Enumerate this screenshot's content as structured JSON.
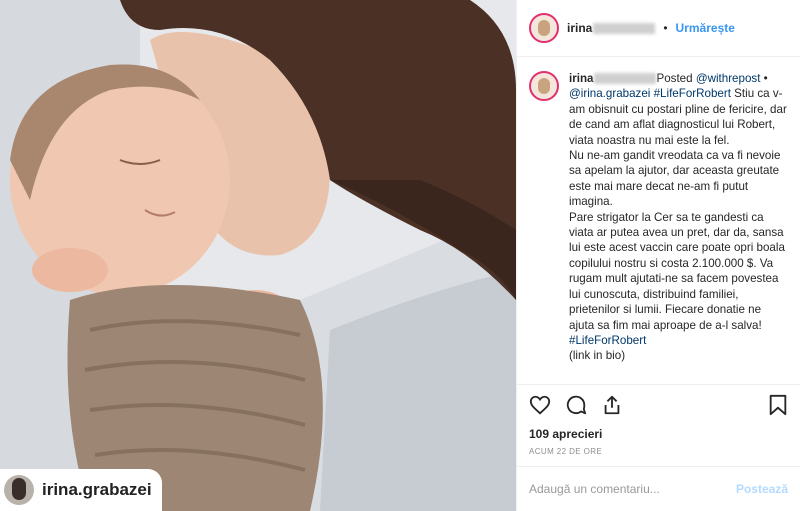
{
  "photo": {
    "credit_name": "irina.grabazei"
  },
  "header": {
    "username_prefix": "irina",
    "separator": "•",
    "follow_label": "Urmărește"
  },
  "caption": {
    "username_prefix": "irina",
    "text_1": "Posted ",
    "mention_1": "@withrepost",
    "text_2": " • ",
    "mention_2": "@irina.grabazei",
    "text_3": " ",
    "hashtag_1": "#LifeForRobert",
    "text_4": " Stiu ca v-am obisnuit cu postari pline de fericire, dar de cand am aflat diagnosticul lui Robert, viata noastra nu mai este la fel.",
    "para_2": "Nu ne-am gandit vreodata ca va fi nevoie sa apelam la ajutor, dar aceasta greutate este mai mare decat ne-am fi putut imagina.",
    "para_3": "Pare strigator la Cer sa te gandesti ca viata ar putea avea un pret, dar da, sansa lui este acest vaccin care poate opri boala copilului nostru si costa 2.100.000 $. Va rugam mult ajutati-ne sa facem povestea lui cunoscuta, distribuind familiei, prietenilor si lumii. Fiecare donatie ne ajuta sa fim mai aproape de a-l salva! ",
    "hashtag_2": "#LifeForRobert",
    "para_4": "(link in bio)"
  },
  "likes": "109 aprecieri",
  "timestamp": "ACUM 22 DE ORE",
  "comment_box": {
    "placeholder": "Adaugă un comentariu...",
    "post_label": "Postează"
  },
  "icons": [
    "heart-icon",
    "comment-icon",
    "share-icon",
    "bookmark-icon"
  ]
}
